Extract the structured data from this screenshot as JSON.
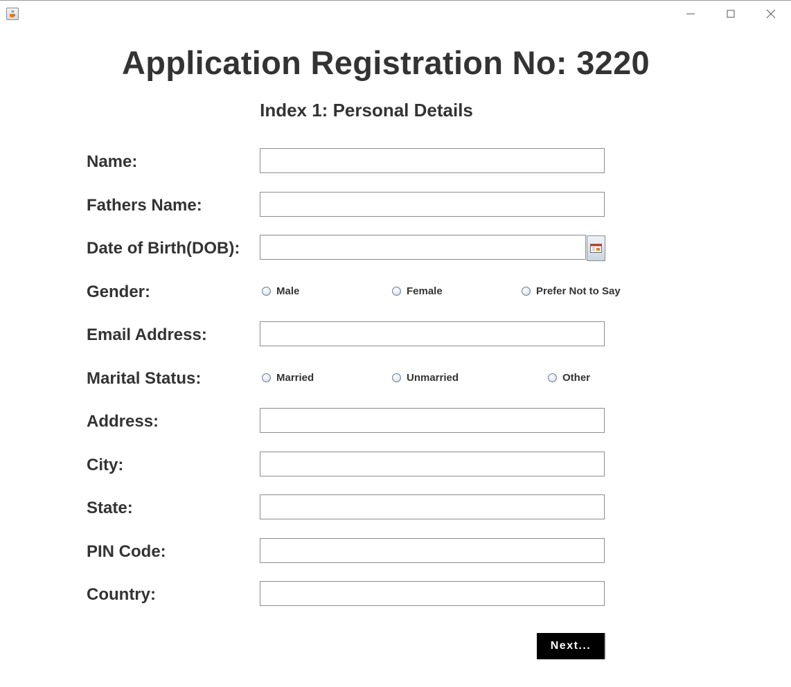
{
  "form": {
    "title": "Application Registration No: 3220",
    "subtitle": "Index 1: Personal Details",
    "labels": {
      "name": "Name:",
      "fathers_name": "Fathers Name:",
      "dob": "Date of Birth(DOB):",
      "gender": "Gender:",
      "email": "Email Address:",
      "marital_status": "Marital Status:",
      "address": "Address:",
      "city": "City:",
      "state": "State:",
      "pin_code": "PIN Code:",
      "country": "Country:"
    },
    "values": {
      "name": "",
      "fathers_name": "",
      "dob": "",
      "email": "",
      "address": "",
      "city": "",
      "state": "",
      "pin_code": "",
      "country": ""
    },
    "gender_options": [
      "Male",
      "Female",
      "Prefer Not to Say"
    ],
    "marital_options": [
      "Married",
      "Unmarried",
      "Other"
    ],
    "next_label": "Next..."
  },
  "icons": {
    "app": "java-cup-icon",
    "calendar": "calendar-icon",
    "minimize": "minimize-icon",
    "maximize": "maximize-icon",
    "close": "close-icon"
  },
  "colors": {
    "text": "#333333",
    "button_bg": "#000000",
    "button_text": "#ffffff",
    "field_border": "#8c8c8c"
  }
}
